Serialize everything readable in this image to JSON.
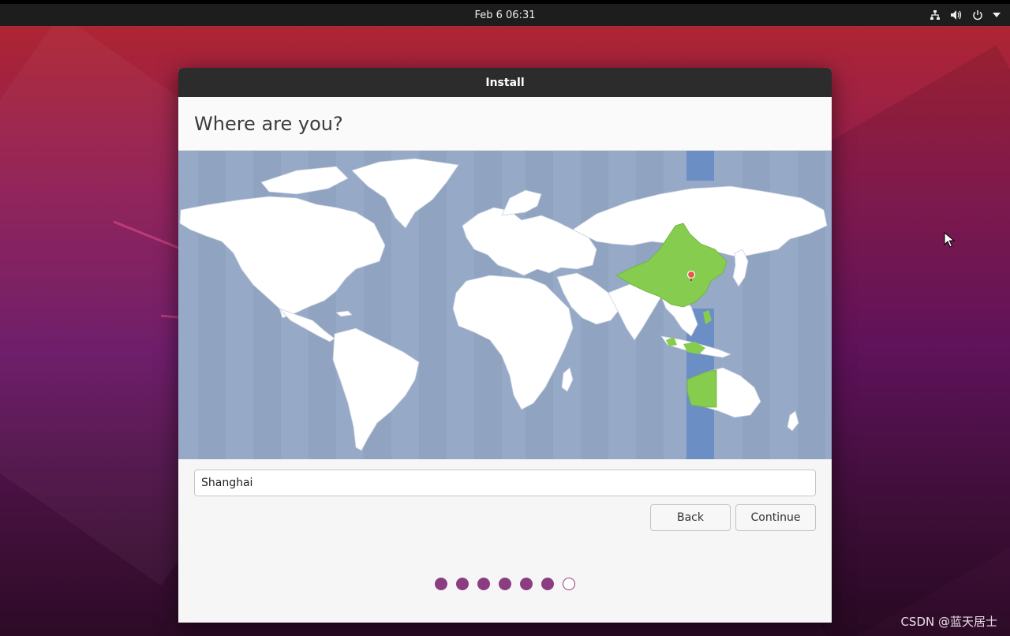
{
  "topbar": {
    "clock": "Feb 6  06:31",
    "icons": [
      "network-icon",
      "volume-icon",
      "power-icon",
      "chevron-down-icon"
    ]
  },
  "window": {
    "title": "Install",
    "heading": "Where are you?"
  },
  "location": {
    "value": "Shanghai",
    "selected_timezone": "Asia/Shanghai",
    "highlight_color": "#86cc4e",
    "band_color": "#6b8fc4",
    "ocean_color": "#96a9c7"
  },
  "buttons": {
    "back": "Back",
    "continue": "Continue"
  },
  "progress": {
    "total_steps": 7,
    "completed_steps": 6,
    "color": "#8b3d82"
  },
  "watermark": "CSDN @蓝天居士"
}
